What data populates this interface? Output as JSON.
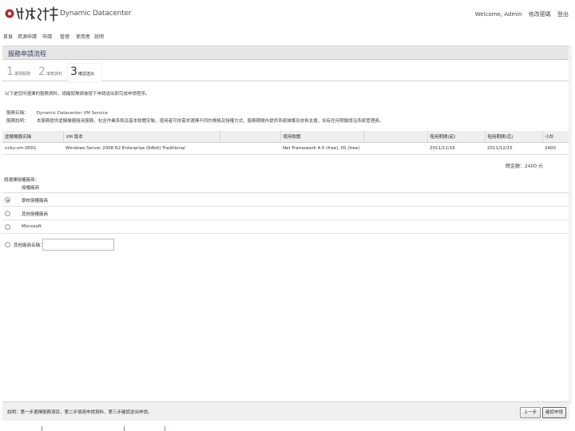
{
  "header": {
    "app_name": "Dynamic Datacenter",
    "welcome": "Welcome, Admin",
    "links": [
      "修改密碼",
      "登出"
    ]
  },
  "menu": [
    "首頁",
    "資源申請",
    "申請",
    "管理",
    "使用者",
    "說明"
  ],
  "page": {
    "title": "服務申請流程"
  },
  "steps": [
    {
      "num": "1",
      "label": "選擇服務"
    },
    {
      "num": "2",
      "label": "填寫資料"
    },
    {
      "num": "3",
      "label": "確認送出"
    }
  ],
  "hint": "以下是您所選擇的服務資料，請確認無誤後按下申請送出即完成申請程序。",
  "info": [
    {
      "key": "服務名稱：",
      "value": "Dynamic Datacenter VM Service"
    },
    {
      "key": "服務說明：",
      "value": "本服務提供虛擬機器租用服務，包含作業系統及基本軟體安裝，使用者可依需求選擇不同的規格及授權方式，服務期間內提供系統維護及技術支援，如有任何問題請洽系統管理員。"
    }
  ],
  "table": {
    "headers": [
      "虛擬機器名稱",
      "VM 版本",
      "",
      "使用軟體",
      "",
      "租用期間(起)",
      "租用期間(迄)",
      "小計"
    ],
    "rows": [
      [
        "ncku-vm-0001",
        "Windows Server 2008 R2 Enterprise (64bit) Traditional",
        "",
        "Net Framework 4.0 (free), IIS (free)",
        "",
        "2011/11/16",
        "2011/12/15",
        "2400"
      ]
    ]
  },
  "price": "總金額：2400 元",
  "vendor": {
    "title": "請選擇授權廠商：",
    "column": "授權廠商",
    "options": [
      {
        "name": "學校授權廠商",
        "checked": true
      },
      {
        "name": "其他授權廠商",
        "checked": false
      },
      {
        "name": "Microsoft",
        "checked": false
      }
    ],
    "other_label": "其他廠商名稱："
  },
  "footer": {
    "note": "說明：第一步選擇服務項目、第二步填寫申請資料、第三步確認送出申請。",
    "prev_label": "上一步",
    "next_label": "確認申請"
  }
}
